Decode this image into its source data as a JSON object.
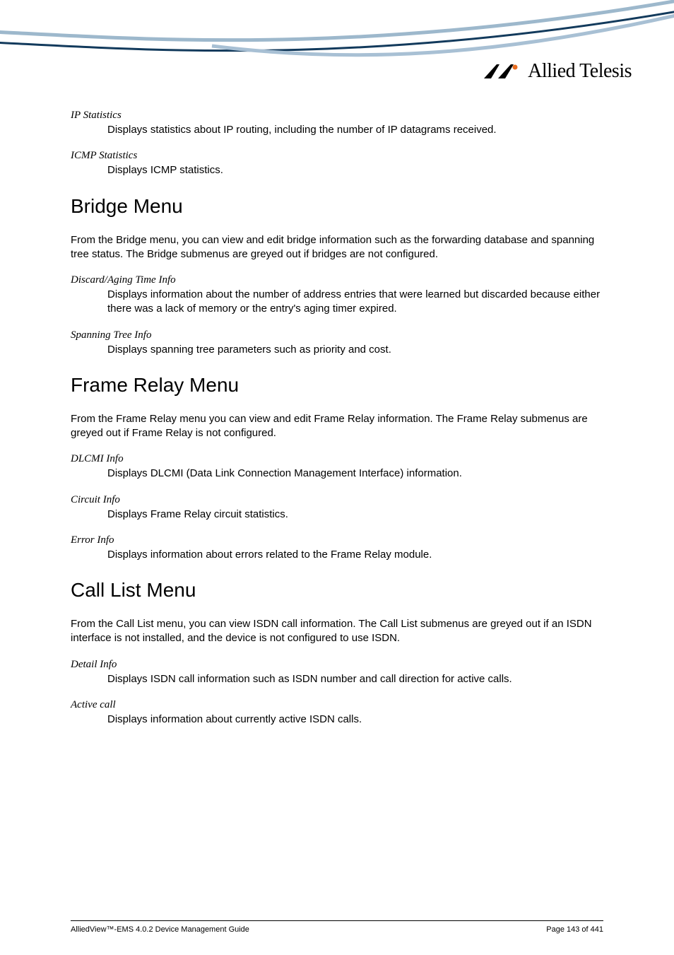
{
  "brand": {
    "name": "Allied Telesis"
  },
  "sections": [
    {
      "items": [
        {
          "term": "IP Statistics",
          "desc": "Displays statistics about IP routing, including the number of IP datagrams received."
        },
        {
          "term": "ICMP Statistics",
          "desc": "Displays ICMP statistics."
        }
      ]
    },
    {
      "heading": "Bridge Menu",
      "intro": "From the Bridge menu, you can view and edit bridge information such as the forwarding database and spanning tree status. The Bridge submenus are greyed out if bridges are not configured.",
      "items": [
        {
          "term": "Discard/Aging Time Info",
          "desc": "Displays information about the number of address entries that were learned but discarded because either there was a lack of memory or the entry's aging timer expired."
        },
        {
          "term": "Spanning Tree Info",
          "desc": "Displays spanning tree parameters such as priority and cost."
        }
      ]
    },
    {
      "heading": "Frame Relay Menu",
      "intro": "From the Frame Relay menu you can view and edit Frame Relay information. The Frame Relay submenus are greyed out if Frame Relay is not configured.",
      "items": [
        {
          "term": "DLCMI Info",
          "desc": "Displays DLCMI (Data Link Connection Management Interface) information."
        },
        {
          "term": "Circuit Info",
          "desc": "Displays Frame Relay circuit statistics."
        },
        {
          "term": "Error Info",
          "desc": "Displays information about errors related to the Frame Relay module."
        }
      ]
    },
    {
      "heading": "Call List Menu",
      "intro": "From the Call List menu, you can view ISDN call information. The Call List submenus are greyed out if an ISDN interface is not installed, and the device is not configured to use ISDN.",
      "items": [
        {
          "term": "Detail Info",
          "desc": "Displays ISDN call information such as ISDN number and call direction for active calls."
        },
        {
          "term": "Active call",
          "desc": "Displays information about currently active ISDN calls."
        }
      ]
    }
  ],
  "footer": {
    "left": "AlliedView™-EMS 4.0.2 Device Management Guide",
    "right": "Page 143 of 441"
  }
}
